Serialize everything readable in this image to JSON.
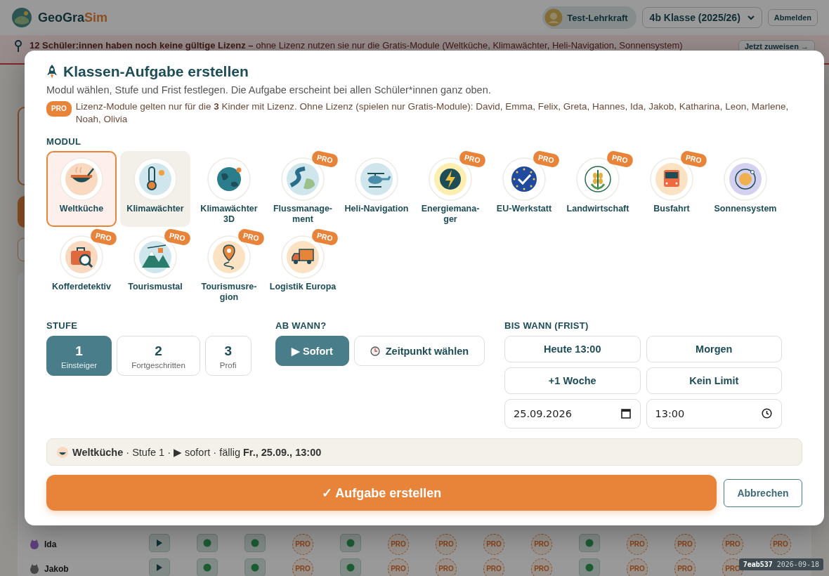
{
  "header": {
    "logo": {
      "main": "GeoGra",
      "accent": "Sim"
    },
    "user": "Test-Lehrkraft",
    "class_select": "4b Klasse (2025/26)",
    "logout": "Abmelden"
  },
  "banner": {
    "text": "**12 Schüler:innen haben noch keine gültige Lizenz –** ohne Lizenz nutzen sie nur die Gratis-Module (Weltküche, Klimawächter, Heli-Navigation, Sonnensystem)",
    "button": "Jetzt zuweisen →"
  },
  "table": {
    "rows": [
      {
        "name": "Ida",
        "cells": [
          {
            "kind": "play"
          },
          {
            "kind": "done"
          },
          {
            "kind": "done"
          },
          {
            "kind": "pro",
            "label": "PRO"
          },
          {
            "kind": "done"
          },
          {
            "kind": "pro",
            "label": "PRO"
          },
          {
            "kind": "pro",
            "label": "PRO"
          },
          {
            "kind": "pro",
            "label": "PRO"
          },
          {
            "kind": "pro",
            "label": "PRO"
          },
          {
            "kind": "done"
          },
          {
            "kind": "pro",
            "label": "PRO"
          },
          {
            "kind": "pro",
            "label": "PRO"
          },
          {
            "kind": "pro",
            "label": "PRO"
          },
          {
            "kind": "pro",
            "label": "PRO"
          }
        ]
      },
      {
        "name": "Jakob",
        "cells": [
          {
            "kind": "play"
          },
          {
            "kind": "done"
          },
          {
            "kind": "done"
          },
          {
            "kind": "pro",
            "label": "PRO"
          },
          {
            "kind": "done"
          },
          {
            "kind": "pro",
            "label": "PRO"
          },
          {
            "kind": "pro",
            "label": "PRO"
          },
          {
            "kind": "pro",
            "label": "PRO"
          },
          {
            "kind": "pro",
            "label": "PRO"
          },
          {
            "kind": "done"
          },
          {
            "kind": "pro",
            "label": "PRO"
          },
          {
            "kind": "pro",
            "label": "PRO"
          },
          {
            "kind": "pro",
            "label": "PRO"
          }
        ]
      }
    ]
  },
  "version": {
    "hash": "7eab537",
    "date": "2026-09-18"
  },
  "dialog": {
    "title": "Klassen-Aufgabe erstellen",
    "subtitle": "Modul wählen, Stufe und Frist festlegen. Die Aufgabe erscheint bei allen Schüler*innen ganz oben.",
    "pro_note": {
      "tag": "PRO",
      "text": "Lizenz-Module gelten nur für die **3** Kinder mit Lizenz. Ohne Lizenz (spielen nur Gratis-Module): David, Emma, Felix, Greta, Hannes, Ida, Jakob, Katharina, Leon, Marlene, Noah, Olivia"
    },
    "module_label": "MODUL",
    "modules": [
      {
        "label": "Weltküche",
        "pro": false,
        "selected": true,
        "hovered": false
      },
      {
        "label": "Klimawächter",
        "pro": false,
        "selected": false,
        "hovered": true
      },
      {
        "label": "Klimawächter 3D",
        "pro": false,
        "selected": false,
        "hovered": false
      },
      {
        "label": "Flussmanage-ment",
        "pro": "PRO",
        "selected": false,
        "hovered": false
      },
      {
        "label": "Heli-Navigation",
        "pro": false,
        "selected": false,
        "hovered": false
      },
      {
        "label": "Energiemana-ger",
        "pro": "PRO",
        "selected": false,
        "hovered": false
      },
      {
        "label": "EU-Werkstatt",
        "pro": "PRO",
        "selected": false,
        "hovered": false
      },
      {
        "label": "Landwirtschaft",
        "pro": "PRO",
        "selected": false,
        "hovered": false
      },
      {
        "label": "Busfahrt",
        "pro": "PRO",
        "selected": false,
        "hovered": false
      },
      {
        "label": "Sonnensystem",
        "pro": false,
        "selected": false,
        "hovered": false
      },
      {
        "label": "Kofferdetektiv",
        "pro": "PRO",
        "selected": false,
        "hovered": false
      },
      {
        "label": "Tourismustal",
        "pro": "PRO",
        "selected": false,
        "hovered": false
      },
      {
        "label": "Tourismusre-gion",
        "pro": "PRO",
        "selected": false,
        "hovered": false
      },
      {
        "label": "Logistik Europa",
        "pro": "PRO",
        "selected": false,
        "hovered": false
      }
    ],
    "level_label": "STUFE",
    "levels": [
      {
        "number": "1",
        "label": "Einsteiger",
        "selected": true
      },
      {
        "number": "2",
        "label": "Fortgeschritten",
        "selected": false
      },
      {
        "number": "3",
        "label": "Profi",
        "selected": false
      }
    ],
    "start_label": "AB WANN?",
    "start_options": [
      {
        "kind": "now",
        "label": "▶ Sofort",
        "selected": true
      },
      {
        "kind": "pick",
        "label": "Zeitpunkt wählen",
        "selected": false
      }
    ],
    "due_label": "BIS WANN (FRIST)",
    "due_options": [
      {
        "label": "Heute 13:00",
        "selected": false
      },
      {
        "label": "Morgen",
        "selected": false
      },
      {
        "label": "+1 Woche",
        "selected": false
      },
      {
        "label": "Kein Limit",
        "selected": false
      }
    ],
    "due_date": "25.09.2026",
    "due_time": "13:00",
    "summary": "**Weltküche** · Stufe 1 · ▶ sofort · fällig **Fr., 25.09., 13:00**",
    "submit": "✓ Aufgabe erstellen",
    "cancel": "Abbrechen"
  }
}
